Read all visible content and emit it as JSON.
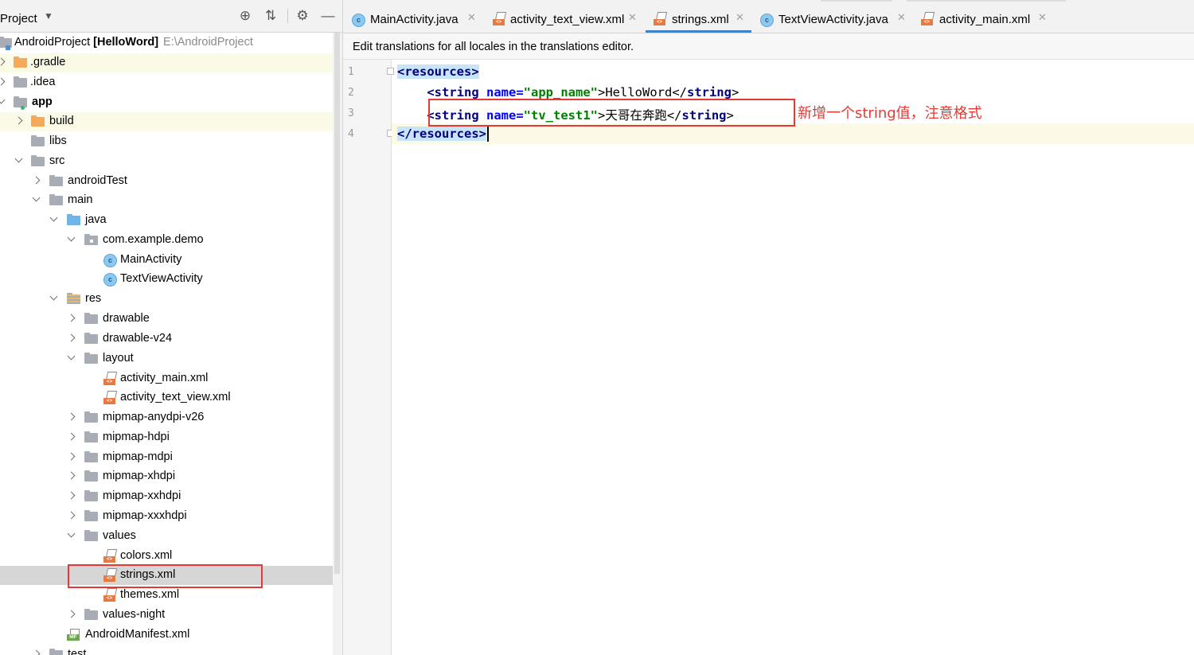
{
  "project_panel": {
    "title": "Project",
    "tree": [
      {
        "label": "AndroidProject",
        "bold_suffix": "[HelloWord]",
        "path": "E:\\AndroidProject"
      },
      {
        "label": ".gradle"
      },
      {
        "label": ".idea"
      },
      {
        "label": "app"
      },
      {
        "label": "build"
      },
      {
        "label": "libs"
      },
      {
        "label": "src"
      },
      {
        "label": "androidTest"
      },
      {
        "label": "main"
      },
      {
        "label": "java"
      },
      {
        "label": "com.example.demo"
      },
      {
        "label": "MainActivity"
      },
      {
        "label": "TextViewActivity"
      },
      {
        "label": "res"
      },
      {
        "label": "drawable"
      },
      {
        "label": "drawable-v24"
      },
      {
        "label": "layout"
      },
      {
        "label": "activity_main.xml"
      },
      {
        "label": "activity_text_view.xml"
      },
      {
        "label": "mipmap-anydpi-v26"
      },
      {
        "label": "mipmap-hdpi"
      },
      {
        "label": "mipmap-mdpi"
      },
      {
        "label": "mipmap-xhdpi"
      },
      {
        "label": "mipmap-xxhdpi"
      },
      {
        "label": "mipmap-xxxhdpi"
      },
      {
        "label": "values"
      },
      {
        "label": "colors.xml"
      },
      {
        "label": "strings.xml"
      },
      {
        "label": "themes.xml"
      },
      {
        "label": "values-night"
      },
      {
        "label": "AndroidManifest.xml"
      },
      {
        "label": "test"
      }
    ]
  },
  "editor": {
    "tabs": [
      {
        "label": "MainActivity.java",
        "icon": "class-icon"
      },
      {
        "label": "activity_text_view.xml",
        "icon": "xml-file-icon"
      },
      {
        "label": "strings.xml",
        "icon": "xml-file-icon",
        "active": true
      },
      {
        "label": "TextViewActivity.java",
        "icon": "class-icon"
      },
      {
        "label": "activity_main.xml",
        "icon": "xml-file-icon"
      }
    ],
    "notice": "Edit translations for all locales in the translations editor.",
    "line_numbers": [
      "1",
      "2",
      "3",
      "4"
    ],
    "code": {
      "l1": "<resources>",
      "l2_open": "<string",
      "l2_attr": "name=",
      "l2_val": "\"app_name\"",
      "l2_text": ">HelloWord</",
      "l2_close": "string",
      "l2_end": ">",
      "l3_open": "<string",
      "l3_attr": "name=",
      "l3_val": "\"tv_test1\"",
      "l3_text": ">天哥在奔跑</",
      "l3_close": "string",
      "l3_end": ">",
      "l4": "</resources>"
    },
    "annotation": "新增一个string值，注意格式"
  },
  "colors": {
    "highlight_red": "#e53935",
    "active_tab_underline": "#4083c9",
    "tag_keyword": "#000080",
    "attribute": "#0000ff",
    "string_value": "#008000"
  }
}
